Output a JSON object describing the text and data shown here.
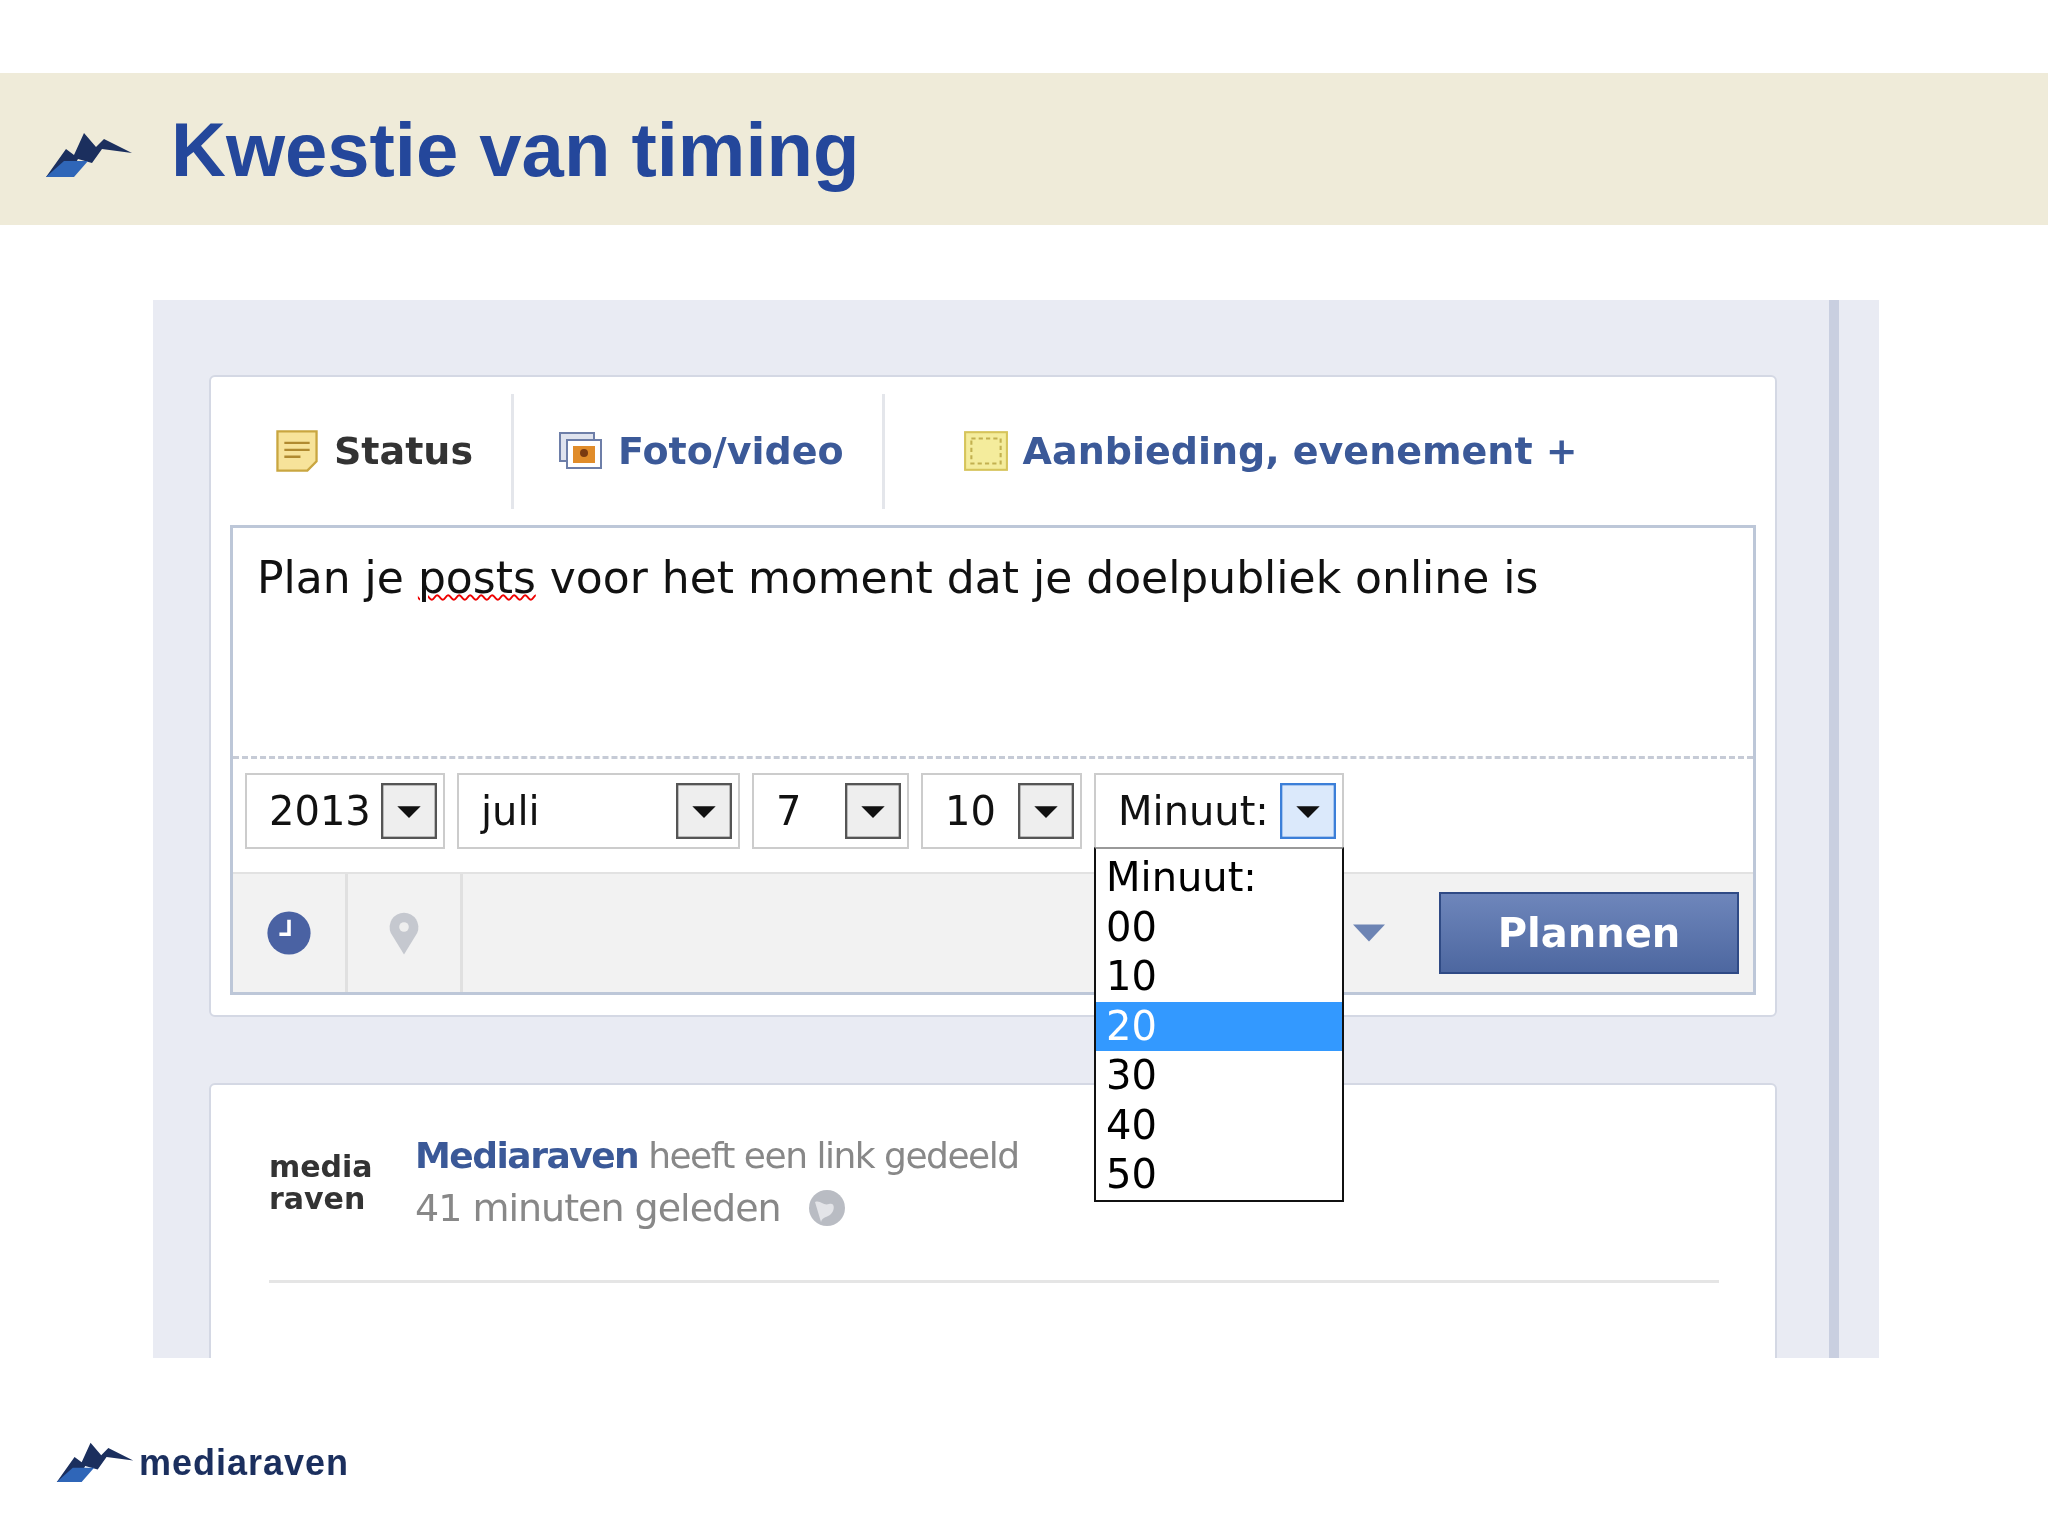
{
  "slide": {
    "title": "Kwestie van timing",
    "footer_logo": "mediaraven"
  },
  "composer": {
    "tabs": [
      {
        "label": "Status",
        "selected": true,
        "kind": "status"
      },
      {
        "label": "Foto/video",
        "selected": false,
        "kind": "photo"
      },
      {
        "label": "Aanbieding, evenement +",
        "selected": false,
        "kind": "offer"
      }
    ],
    "post_text": [
      {
        "text": "Plan je ",
        "misspelled": false
      },
      {
        "text": "posts",
        "misspelled": true
      },
      {
        "text": " voor het moment dat je doelpubliek online is",
        "misspelled": false
      }
    ],
    "selects": [
      {
        "value": "2013",
        "open": false
      },
      {
        "value": "juli",
        "open": false
      },
      {
        "value": "7",
        "open": false
      },
      {
        "value": "10",
        "open": false
      },
      {
        "value": "Minuut:",
        "open": true
      }
    ],
    "options": [
      {
        "label": "Minuut:",
        "selected": false
      },
      {
        "label": "00",
        "selected": false
      },
      {
        "label": "10",
        "selected": false
      },
      {
        "label": "20",
        "selected": true
      },
      {
        "label": "30",
        "selected": false
      },
      {
        "label": "40",
        "selected": false
      },
      {
        "label": "50",
        "selected": false
      }
    ],
    "button": "Plannen"
  },
  "feed": {
    "avatar_lines": [
      "media",
      "raven"
    ],
    "author": "Mediaraven",
    "action": "heeft een link gedeeld",
    "time": "41 minuten geleden"
  }
}
